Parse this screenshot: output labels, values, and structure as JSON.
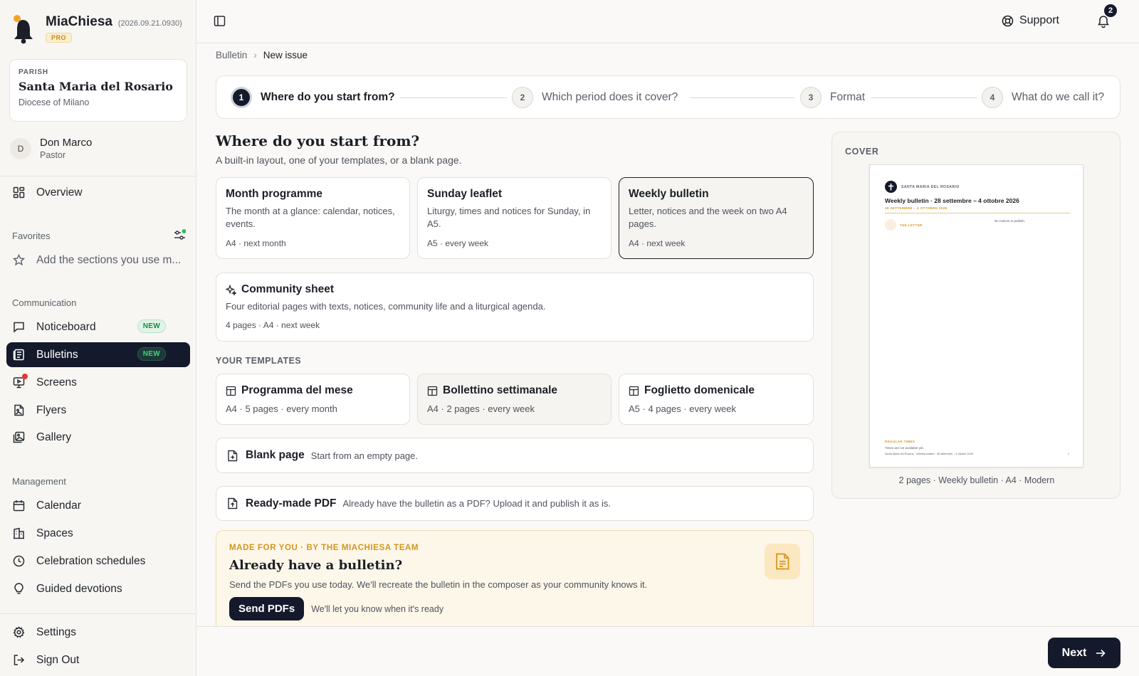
{
  "app": {
    "name": "MiaChiesa",
    "version": "(2026.09.21.0930)",
    "plan_badge": "PRO"
  },
  "parish": {
    "label": "PARISH",
    "name": "Santa Maria del Rosario",
    "diocese": "Diocese of Milano"
  },
  "user": {
    "initial": "D",
    "name": "Don Marco",
    "role": "Pastor"
  },
  "nav": {
    "overview": "Overview",
    "favorites_label": "Favorites",
    "favorites_empty": "Add the sections you use m...",
    "communication_label": "Communication",
    "noticeboard": "Noticeboard",
    "bulletins": "Bulletins",
    "screens": "Screens",
    "flyers": "Flyers",
    "gallery": "Gallery",
    "management_label": "Management",
    "calendar": "Calendar",
    "spaces": "Spaces",
    "celebration": "Celebration schedules",
    "devotions": "Guided devotions",
    "settings": "Settings",
    "signout": "Sign Out",
    "new_badge": "NEW"
  },
  "topbar": {
    "support": "Support",
    "notifications_count": "2"
  },
  "breadcrumb": {
    "parent": "Bulletin",
    "current": "New issue"
  },
  "steps": [
    {
      "num": "1",
      "label": "Where do you start from?"
    },
    {
      "num": "2",
      "label": "Which period does it cover?"
    },
    {
      "num": "3",
      "label": "Format"
    },
    {
      "num": "4",
      "label": "What do we call it?"
    }
  ],
  "main": {
    "title": "Where do you start from?",
    "subtitle": "A built-in layout, one of your templates, or a blank page."
  },
  "layouts": [
    {
      "title": "Month programme",
      "desc": "The month at a glance: calendar, notices, events.",
      "meta": "A4 · next month"
    },
    {
      "title": "Sunday leaflet",
      "desc": "Liturgy, times and notices for Sunday, in A5.",
      "meta": "A5 · every week"
    },
    {
      "title": "Weekly bulletin",
      "desc": "Letter, notices and the week on two A4 pages.",
      "meta": "A4 · next week"
    }
  ],
  "community": {
    "title": "Community sheet",
    "desc": "Four editorial pages with texts, notices, community life and a liturgical agenda.",
    "meta": "4 pages · A4 · next week"
  },
  "templates": {
    "label": "YOUR TEMPLATES",
    "items": [
      {
        "title": "Programma del mese",
        "meta": "A4 · 5 pages · every month"
      },
      {
        "title": "Bollettino settimanale",
        "meta": "A4 · 2 pages · every week"
      },
      {
        "title": "Foglietto domenicale",
        "meta": "A5 · 4 pages · every week"
      }
    ]
  },
  "blank": {
    "title": "Blank page",
    "desc": "Start from an empty page."
  },
  "pdf": {
    "title": "Ready-made PDF",
    "desc": "Already have the bulletin as a PDF? Upload it and publish it as is."
  },
  "promo": {
    "eyebrow": "MADE FOR YOU · BY THE MIACHIESA TEAM",
    "title": "Already have a bulletin?",
    "desc": "Send the PDFs you use today. We'll recreate the bulletin in the composer as your community knows it.",
    "button": "Send PDFs",
    "note": "We'll let you know when it's ready"
  },
  "cover": {
    "label": "COVER",
    "page_parish": "SANTA MARIA DEL ROSARIO",
    "page_title": "Weekly bulletin · 28 settembre – 4 ottobre 2026",
    "page_dates": "28 SETTEMBRE – 4 OTTOBRE 2026",
    "page_letter": "THE LETTER",
    "page_notices": "No notices to publish.",
    "page_regular": "REGULAR TIMES",
    "page_regular_sub": "Times are not available yet.",
    "page_footer": "Santa Maria del Rosario · Weekly bulletin · 28 settembre – 4 ottobre 2026",
    "page_number": "1",
    "caption": "2 pages · Weekly bulletin · A4 · Modern"
  },
  "footer": {
    "next": "Next"
  },
  "colors": {
    "accent_dark": "#141a2c",
    "badge_green": "#1e8a49",
    "promo_gold": "#d4961c",
    "alert_red": "#e53935"
  }
}
